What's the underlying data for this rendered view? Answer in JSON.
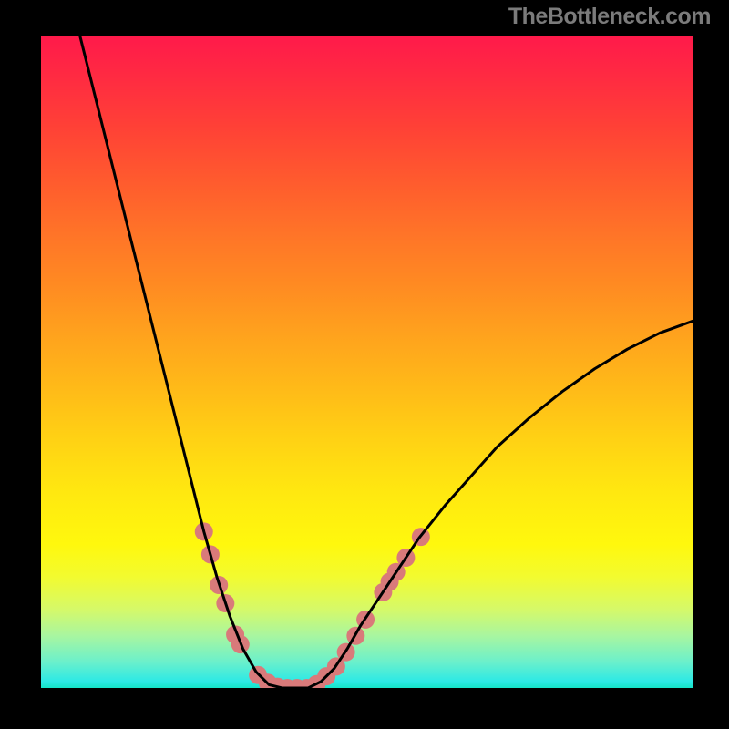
{
  "attribution": "TheBottleneck.com",
  "chart_data": {
    "type": "line",
    "title": "",
    "xlabel": "",
    "ylabel": "",
    "xlim": [
      0,
      1
    ],
    "ylim": [
      0,
      1
    ],
    "curve_points": [
      {
        "x": 0.06,
        "y": 1.0
      },
      {
        "x": 0.075,
        "y": 0.94
      },
      {
        "x": 0.09,
        "y": 0.88
      },
      {
        "x": 0.11,
        "y": 0.8
      },
      {
        "x": 0.13,
        "y": 0.72
      },
      {
        "x": 0.15,
        "y": 0.64
      },
      {
        "x": 0.17,
        "y": 0.56
      },
      {
        "x": 0.19,
        "y": 0.48
      },
      {
        "x": 0.21,
        "y": 0.4
      },
      {
        "x": 0.23,
        "y": 0.32
      },
      {
        "x": 0.25,
        "y": 0.24
      },
      {
        "x": 0.27,
        "y": 0.17
      },
      {
        "x": 0.29,
        "y": 0.11
      },
      {
        "x": 0.31,
        "y": 0.06
      },
      {
        "x": 0.33,
        "y": 0.025
      },
      {
        "x": 0.35,
        "y": 0.005
      },
      {
        "x": 0.37,
        "y": 0.0
      },
      {
        "x": 0.39,
        "y": 0.0
      },
      {
        "x": 0.41,
        "y": 0.0
      },
      {
        "x": 0.43,
        "y": 0.01
      },
      {
        "x": 0.45,
        "y": 0.03
      },
      {
        "x": 0.47,
        "y": 0.06
      },
      {
        "x": 0.49,
        "y": 0.095
      },
      {
        "x": 0.52,
        "y": 0.14
      },
      {
        "x": 0.55,
        "y": 0.185
      },
      {
        "x": 0.58,
        "y": 0.23
      },
      {
        "x": 0.62,
        "y": 0.28
      },
      {
        "x": 0.66,
        "y": 0.325
      },
      {
        "x": 0.7,
        "y": 0.37
      },
      {
        "x": 0.75,
        "y": 0.415
      },
      {
        "x": 0.8,
        "y": 0.455
      },
      {
        "x": 0.85,
        "y": 0.49
      },
      {
        "x": 0.9,
        "y": 0.52
      },
      {
        "x": 0.95,
        "y": 0.545
      },
      {
        "x": 1.0,
        "y": 0.563
      }
    ],
    "marker_clusters": [
      {
        "x": 0.25,
        "y": 0.24,
        "r": 10
      },
      {
        "x": 0.26,
        "y": 0.205,
        "r": 10
      },
      {
        "x": 0.273,
        "y": 0.158,
        "r": 10
      },
      {
        "x": 0.283,
        "y": 0.13,
        "r": 10
      },
      {
        "x": 0.298,
        "y": 0.082,
        "r": 10
      },
      {
        "x": 0.306,
        "y": 0.067,
        "r": 10
      },
      {
        "x": 0.333,
        "y": 0.02,
        "r": 10
      },
      {
        "x": 0.348,
        "y": 0.008,
        "r": 10
      },
      {
        "x": 0.363,
        "y": 0.002,
        "r": 10
      },
      {
        "x": 0.378,
        "y": 0.0,
        "r": 10
      },
      {
        "x": 0.393,
        "y": 0.0,
        "r": 10
      },
      {
        "x": 0.408,
        "y": 0.0,
        "r": 10
      },
      {
        "x": 0.423,
        "y": 0.006,
        "r": 10
      },
      {
        "x": 0.438,
        "y": 0.018,
        "r": 10
      },
      {
        "x": 0.453,
        "y": 0.033,
        "r": 10
      },
      {
        "x": 0.468,
        "y": 0.055,
        "r": 10
      },
      {
        "x": 0.483,
        "y": 0.08,
        "r": 10
      },
      {
        "x": 0.498,
        "y": 0.105,
        "r": 10
      },
      {
        "x": 0.525,
        "y": 0.147,
        "r": 10
      },
      {
        "x": 0.535,
        "y": 0.163,
        "r": 10
      },
      {
        "x": 0.545,
        "y": 0.178,
        "r": 10
      },
      {
        "x": 0.56,
        "y": 0.2,
        "r": 10
      },
      {
        "x": 0.583,
        "y": 0.232,
        "r": 10
      }
    ],
    "colors": {
      "curve": "#000000",
      "marker_fill": "#d97a7a",
      "marker_stroke": "#c86868"
    }
  }
}
